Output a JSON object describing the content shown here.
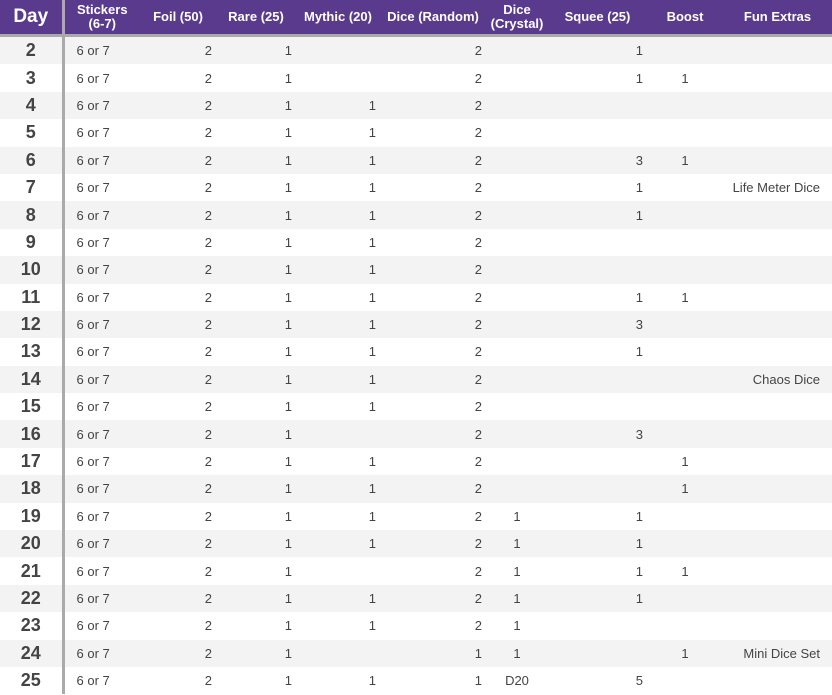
{
  "headers": {
    "day": "Day",
    "stickers_1": "Stickers",
    "stickers_2": "(6-7)",
    "foil": "Foil (50)",
    "rare": "Rare (25)",
    "mythic": "Mythic (20)",
    "dice_random": "Dice (Random)",
    "crystal_1": "Dice",
    "crystal_2": "(Crystal)",
    "squee": "Squee (25)",
    "boost": "Boost",
    "extras": "Fun Extras"
  },
  "colors": {
    "header": "#5a3a8c",
    "alt_row": "#f3f3f3"
  },
  "rows": [
    [
      "2",
      "6 or 7",
      "2",
      "1",
      "",
      "2",
      "",
      "1",
      "",
      ""
    ],
    [
      "3",
      "6 or 7",
      "2",
      "1",
      "",
      "2",
      "",
      "1",
      "1",
      ""
    ],
    [
      "4",
      "6 or 7",
      "2",
      "1",
      "1",
      "2",
      "",
      "",
      "",
      ""
    ],
    [
      "5",
      "6 or 7",
      "2",
      "1",
      "1",
      "2",
      "",
      "",
      "",
      ""
    ],
    [
      "6",
      "6 or 7",
      "2",
      "1",
      "1",
      "2",
      "",
      "3",
      "1",
      ""
    ],
    [
      "7",
      "6 or 7",
      "2",
      "1",
      "1",
      "2",
      "",
      "1",
      "",
      "Life Meter Dice"
    ],
    [
      "8",
      "6 or 7",
      "2",
      "1",
      "1",
      "2",
      "",
      "1",
      "",
      ""
    ],
    [
      "9",
      "6 or 7",
      "2",
      "1",
      "1",
      "2",
      "",
      "",
      "",
      ""
    ],
    [
      "10",
      "6 or 7",
      "2",
      "1",
      "1",
      "2",
      "",
      "",
      "",
      ""
    ],
    [
      "11",
      "6 or 7",
      "2",
      "1",
      "1",
      "2",
      "",
      "1",
      "1",
      ""
    ],
    [
      "12",
      "6 or 7",
      "2",
      "1",
      "1",
      "2",
      "",
      "3",
      "",
      ""
    ],
    [
      "13",
      "6 or 7",
      "2",
      "1",
      "1",
      "2",
      "",
      "1",
      "",
      ""
    ],
    [
      "14",
      "6 or 7",
      "2",
      "1",
      "1",
      "2",
      "",
      "",
      "",
      "Chaos Dice"
    ],
    [
      "15",
      "6 or 7",
      "2",
      "1",
      "1",
      "2",
      "",
      "",
      "",
      ""
    ],
    [
      "16",
      "6 or 7",
      "2",
      "1",
      "",
      "2",
      "",
      "3",
      "",
      ""
    ],
    [
      "17",
      "6 or 7",
      "2",
      "1",
      "1",
      "2",
      "",
      "",
      "1",
      ""
    ],
    [
      "18",
      "6 or 7",
      "2",
      "1",
      "1",
      "2",
      "",
      "",
      "1",
      ""
    ],
    [
      "19",
      "6 or 7",
      "2",
      "1",
      "1",
      "2",
      "1",
      "1",
      "",
      ""
    ],
    [
      "20",
      "6 or 7",
      "2",
      "1",
      "1",
      "2",
      "1",
      "1",
      "",
      ""
    ],
    [
      "21",
      "6 or 7",
      "2",
      "1",
      "",
      "2",
      "1",
      "1",
      "1",
      ""
    ],
    [
      "22",
      "6 or 7",
      "2",
      "1",
      "1",
      "2",
      "1",
      "1",
      "",
      ""
    ],
    [
      "23",
      "6 or 7",
      "2",
      "1",
      "1",
      "2",
      "1",
      "",
      "",
      ""
    ],
    [
      "24",
      "6 or 7",
      "2",
      "1",
      "",
      "1",
      "1",
      "",
      "1",
      "Mini Dice Set"
    ],
    [
      "25",
      "6 or 7",
      "2",
      "1",
      "1",
      "1",
      "D20",
      "5",
      "",
      ""
    ]
  ]
}
